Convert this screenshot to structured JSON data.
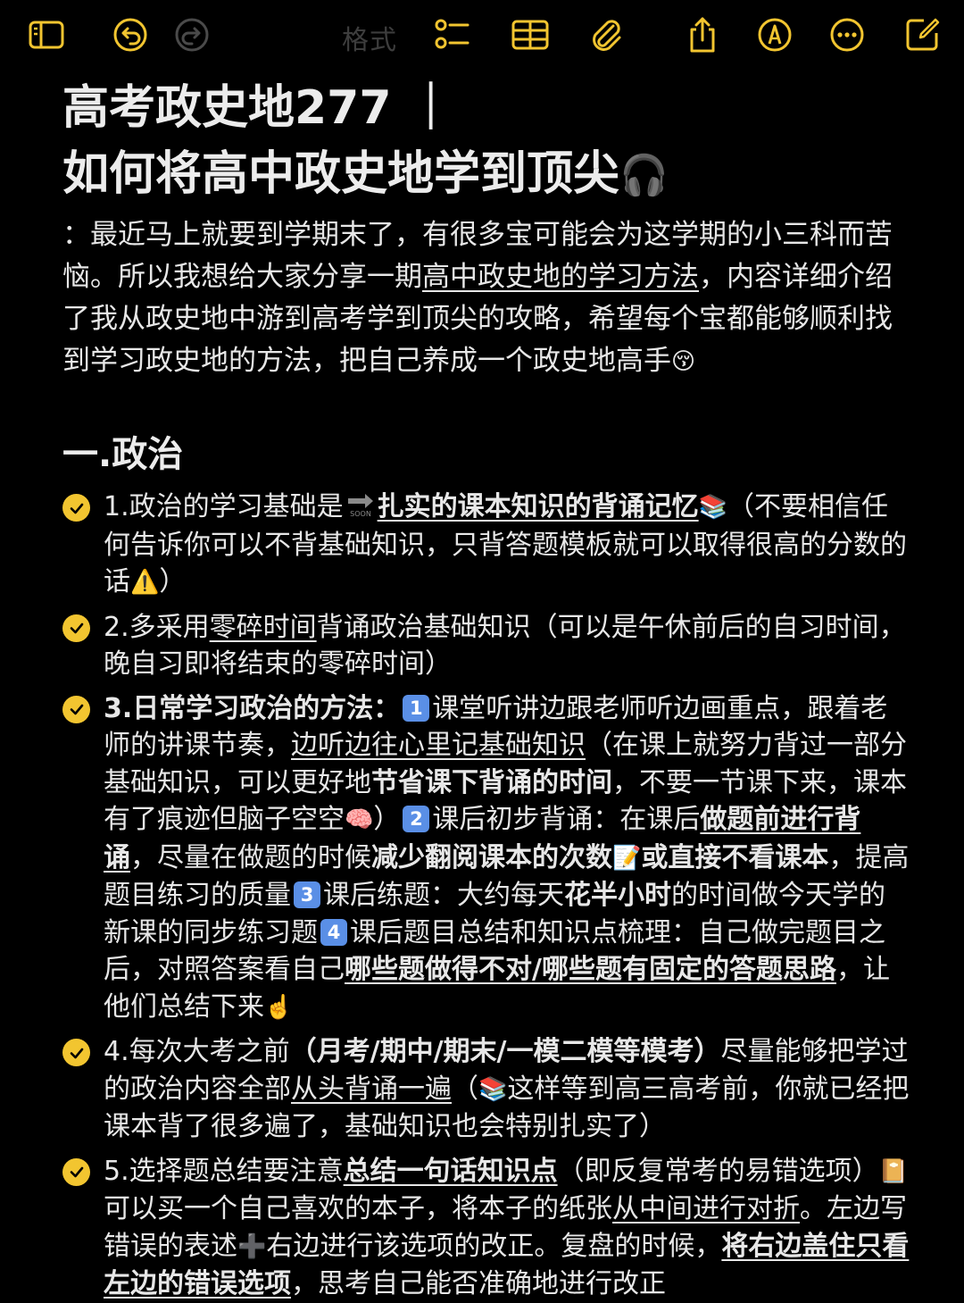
{
  "toolbar": {
    "format_label": "格式",
    "icons": [
      "sidebar-icon",
      "undo-icon",
      "redo-icon",
      "checklist-icon",
      "table-icon",
      "attachment-icon",
      "share-icon",
      "markup-icon",
      "more-icon",
      "compose-icon"
    ]
  },
  "colors": {
    "accent": "#f2c530",
    "background": "#000000",
    "text": "#e7e7e7",
    "keycap": "#5a8fe6"
  },
  "note": {
    "title_line1": "高考政史地277 ｜",
    "title_line2": "如何将高中政史地学到顶尖",
    "title_emoji": "🎧",
    "intro": {
      "p1": "：最近马上就要到学期末了，有很多宝可能会为这学期的小三科而苦恼。所以我想给大家分享一期",
      "link": "高中政史地的学习方法",
      "p2": "，内容详细介绍了我从政史地中游到高考学到顶尖的攻略，希望每个宝都能够顺利找到学习政史地的方法，把自己养成一个政史地高手",
      "emoji": "😚"
    },
    "section_title": "一.政治",
    "items": [
      {
        "a": "1.政治的学习基础是",
        "soon": "SOON",
        "b": "扎实的课本知识的背诵记忆",
        "e1": "📚",
        "c": "（不要相信任何告诉你可以不背基础知识，只背答题模板就可以取得很高的分数的话",
        "e2": "⚠️",
        "d": "）"
      },
      {
        "a": "2.多采用",
        "b": "零碎时间",
        "c": "背诵政治基础知识（可以是午休前后的自习时间，晚自习即将结束的零碎时间）"
      },
      {
        "a": "3.日常学习政治的方法：",
        "k1": "1",
        "b": "课堂听讲边跟老师听边画重点，跟着老师的讲课节奏，",
        "c": "边听边往心里记基础知识",
        "d": "（在课上就努力背过一部分基础知识，可以更好地",
        "e": "节省课下背诵的时间",
        "f": "，不要一节课下来，课本有了痕迹但脑子空空",
        "e1": "🧠",
        "g": "）",
        "k2": "2",
        "h": "课后初步背诵：在课后",
        "i": "做题前进行背诵",
        "j": "，尽量在做题的时候",
        "k": "减少翻阅课本的次数",
        "e2": "📝",
        "l": "或直接不看课本",
        "m": "，提高题目练习的质量",
        "k3": "3",
        "n": "课后练题：大约每天",
        "o": "花半小时",
        "p": "的时间做今天学的新课的同步练习题",
        "k4": "4",
        "q": "课后题目总结和知识点梳理：自己做完题目之后，对照答案看自己",
        "r": "哪些题做得不对/哪些题有固定的答题思路",
        "s": "，让他们总结下来",
        "e3": "☝️"
      },
      {
        "a": "4.每次大考之前",
        "b": "（月考/期中/期末/一模二模等模考）",
        "c": "尽量能够把学过的政治内容全部",
        "d": "从头背诵一遍",
        "e": "（",
        "e1": "📚",
        "f": "这样等到高三高考前，你就已经把课本背了很多遍了，基础知识也会特别扎实了）"
      },
      {
        "a": "5.选择题总结要注意",
        "b": "总结一句话知识点",
        "c": "（即反复常考的易错选项）",
        "e1": "📔",
        "d": "可以买一个自己喜欢的本子，将本子的纸张",
        "e": "从中间进行对折",
        "f": "。左边写错误的表述",
        "e2": "➕",
        "g": "右边进行该选项的改正。复盘的时候，",
        "h": "将右边盖住只看左边的错误选项",
        "i": "，思考自己能否准确地进行改正"
      }
    ]
  }
}
